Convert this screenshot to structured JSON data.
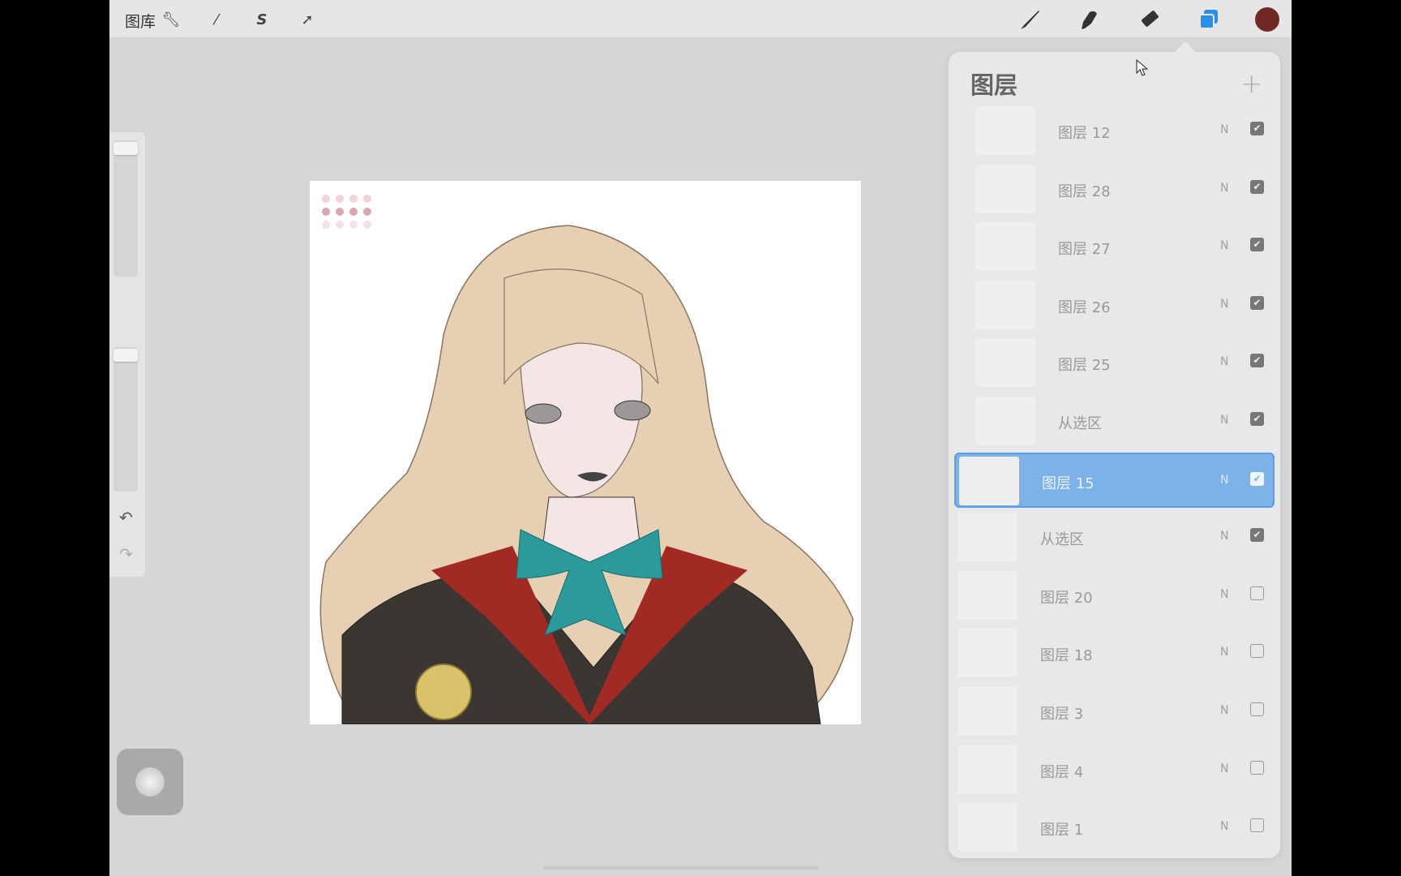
{
  "topbar": {
    "gallery_label": "图库",
    "left_tools": [
      "wrench-icon",
      "magic-wand-icon",
      "selection-icon",
      "transform-arrow-icon"
    ],
    "right_tools": [
      "brush-icon",
      "smudge-icon",
      "eraser-icon",
      "layers-icon"
    ],
    "current_color": "#6e2a22",
    "accent": "#2b8fe8"
  },
  "layers_panel": {
    "title": "图层",
    "add_icon": "plus-icon",
    "layers": [
      {
        "name": "图层 12",
        "blend": "N",
        "visible": true,
        "grouped": true,
        "selected": false
      },
      {
        "name": "图层 28",
        "blend": "N",
        "visible": true,
        "grouped": true,
        "selected": false
      },
      {
        "name": "图层 27",
        "blend": "N",
        "visible": true,
        "grouped": true,
        "selected": false
      },
      {
        "name": "图层 26",
        "blend": "N",
        "visible": true,
        "grouped": true,
        "selected": false
      },
      {
        "name": "图层 25",
        "blend": "N",
        "visible": true,
        "grouped": true,
        "selected": false
      },
      {
        "name": "从选区",
        "blend": "N",
        "visible": true,
        "grouped": true,
        "selected": false
      },
      {
        "name": "图层 15",
        "blend": "N",
        "visible": true,
        "grouped": false,
        "selected": true
      },
      {
        "name": "从选区",
        "blend": "N",
        "visible": true,
        "grouped": false,
        "selected": false
      },
      {
        "name": "图层 20",
        "blend": "N",
        "visible": false,
        "grouped": false,
        "selected": false
      },
      {
        "name": "图层 18",
        "blend": "N",
        "visible": false,
        "grouped": false,
        "selected": false
      },
      {
        "name": "图层 3",
        "blend": "N",
        "visible": false,
        "grouped": false,
        "selected": false
      },
      {
        "name": "图层 4",
        "blend": "N",
        "visible": false,
        "grouped": false,
        "selected": false
      },
      {
        "name": "图层 1",
        "blend": "N",
        "visible": false,
        "grouped": false,
        "selected": false
      }
    ],
    "selected_color": "#7db2e8"
  },
  "sidebar": {
    "brush_size": 0.97,
    "opacity": 0.97,
    "undo_icon": "undo-icon",
    "redo_icon": "redo-icon"
  }
}
